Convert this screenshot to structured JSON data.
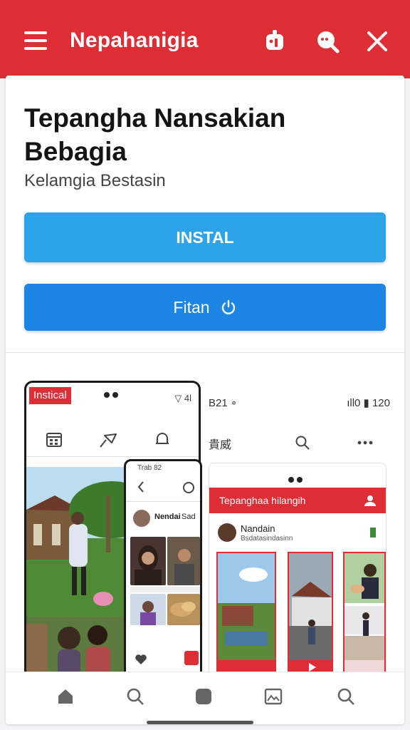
{
  "topbar": {
    "title": "Nepahanigia",
    "icons": [
      "menu-icon",
      "share-icon",
      "search-icon",
      "close-icon"
    ]
  },
  "app": {
    "name": "Tepangha Nansakian Bebagia",
    "developer": "Kelamgia Bestasin"
  },
  "buttons": {
    "install_label": "INSTAL",
    "open_label": "Fitan"
  },
  "screenshots": {
    "phone1": {
      "badge": "Instical",
      "status": "▽ 4l",
      "toolbar_icons": [
        "calendar-icon",
        "pin-icon",
        "bell-icon"
      ]
    },
    "phone2": {
      "status": "Trab  82",
      "user": "Nendai",
      "user_suffix": "Sad"
    },
    "phone3": {
      "status_left": "B21 ∘",
      "status_right": "ıll0 ▮ 120",
      "tab_label": "貴威",
      "header": "Tepanghaa hilangih",
      "user": "Nandain",
      "user_sub": "Bsdatasindasinn"
    }
  },
  "bottom_nav": [
    "home-icon",
    "search-icon",
    "apps-icon",
    "gallery-icon",
    "search-icon"
  ],
  "colors": {
    "brand_red": "#dd2e35",
    "install_blue": "#2da3ea",
    "open_blue": "#1d86e4"
  }
}
